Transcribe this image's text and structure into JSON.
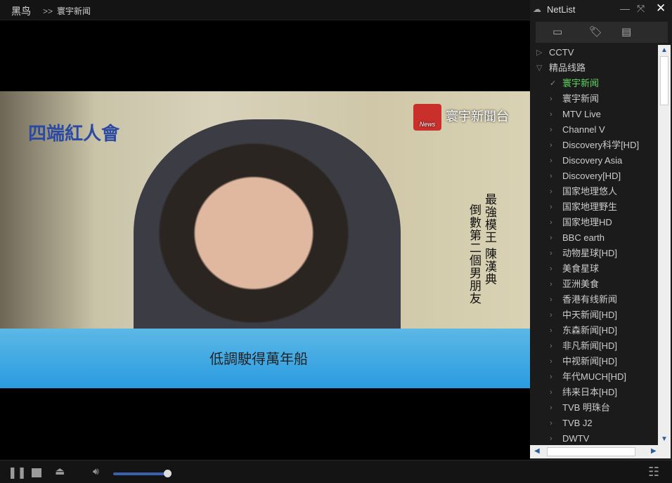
{
  "titlebar": {
    "app_name": "黑鸟",
    "breadcrumb_sep": ">>",
    "breadcrumb_current": "寰宇新闻"
  },
  "video": {
    "channel_logo": "News",
    "channel_name": "寰宇新聞台",
    "show_logo": "四端紅人會",
    "side_text_1": "最強模王 陳漢典",
    "side_text_2": "倒數第二個男朋友",
    "subtitle": "低調駛得萬年船"
  },
  "controls": {
    "volume_percent": 100,
    "accent": "#3a5fb0"
  },
  "panel": {
    "title": "NetList",
    "tabs": [
      "monitor-icon",
      "tag-icon",
      "film-icon"
    ],
    "groups": [
      {
        "label": "CCTV",
        "expanded": false
      },
      {
        "label": "精品线路",
        "expanded": true
      }
    ],
    "channels": [
      {
        "label": "寰宇新闻",
        "active": true
      },
      {
        "label": "寰宇新闻"
      },
      {
        "label": "MTV Live"
      },
      {
        "label": "Channel V"
      },
      {
        "label": "Discovery科学[HD]"
      },
      {
        "label": "Discovery Asia"
      },
      {
        "label": "Discovery[HD]"
      },
      {
        "label": "国家地理悠人"
      },
      {
        "label": "国家地理野生"
      },
      {
        "label": "国家地理HD"
      },
      {
        "label": "BBC earth"
      },
      {
        "label": "动物星球[HD]"
      },
      {
        "label": "美食星球"
      },
      {
        "label": "亚洲美食"
      },
      {
        "label": "香港有线新闻"
      },
      {
        "label": "中天新闻[HD]"
      },
      {
        "label": "东森新闻[HD]"
      },
      {
        "label": "非凡新闻[HD]"
      },
      {
        "label": "中视新闻[HD]"
      },
      {
        "label": "年代MUCH[HD]"
      },
      {
        "label": "纬来日本[HD]"
      },
      {
        "label": "TVB 明珠台"
      },
      {
        "label": "TVB J2"
      },
      {
        "label": "DWTV"
      }
    ],
    "active_color": "#5fd35f"
  }
}
